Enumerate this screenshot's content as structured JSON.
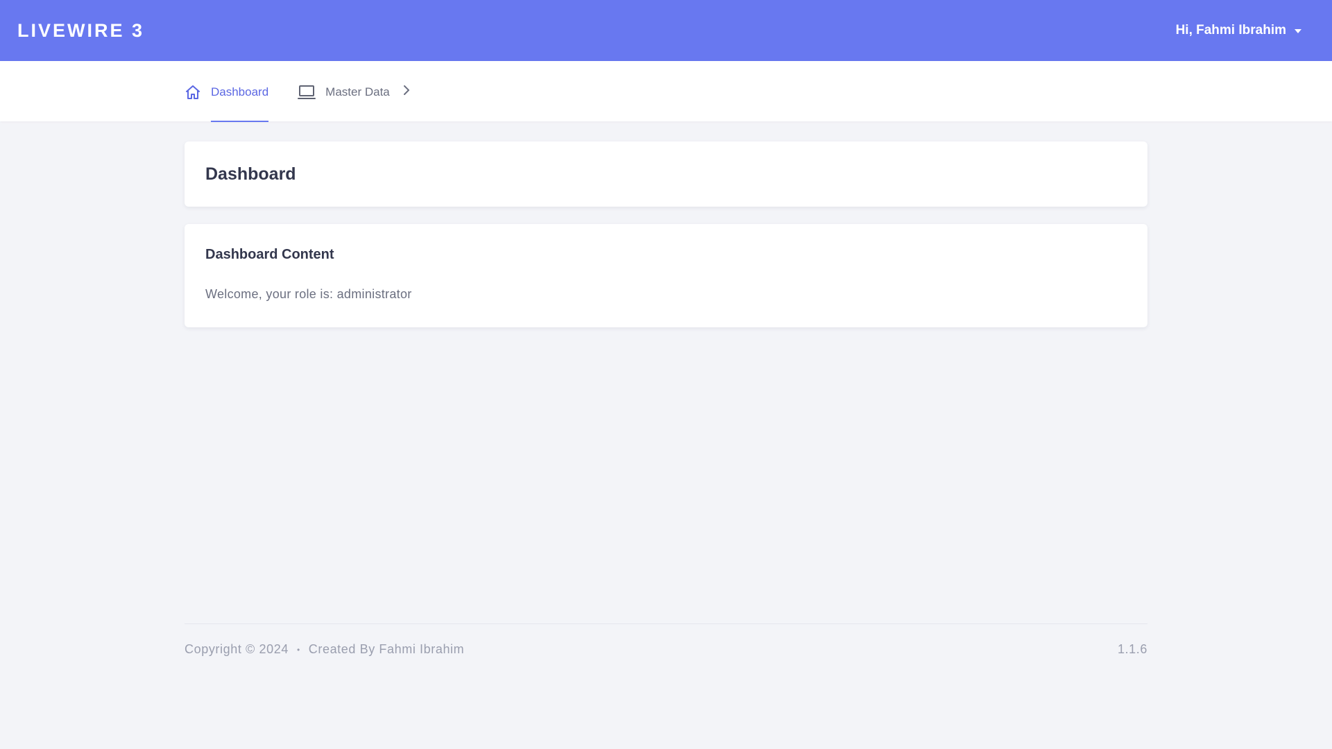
{
  "header": {
    "brand": "LIVEWIRE 3",
    "user_greeting": "Hi, Fahmi Ibrahim"
  },
  "nav": {
    "items": [
      {
        "label": "Dashboard",
        "icon": "home-icon",
        "active": true
      },
      {
        "label": "Master Data",
        "icon": "laptop-icon",
        "has_submenu": true
      }
    ]
  },
  "page": {
    "title": "Dashboard",
    "content_title": "Dashboard Content",
    "content_text": "Welcome, your role is: administrator"
  },
  "footer": {
    "copyright": "Copyright © 2024",
    "separator": "•",
    "created_by": "Created By Fahmi Ibrahim",
    "version": "1.1.6"
  },
  "colors": {
    "primary": "#6878f0",
    "background": "#f3f4f8",
    "active_nav": "#5b67e3"
  }
}
